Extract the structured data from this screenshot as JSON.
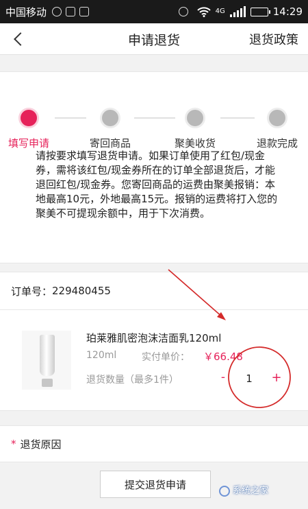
{
  "status_bar": {
    "carrier": "中国移动",
    "network": "4G",
    "time": "14:29",
    "battery_level": 0.6
  },
  "nav": {
    "title": "申请退货",
    "right_label": "退货政策",
    "back_icon": "chevron-left-icon"
  },
  "steps": [
    {
      "label": "填写申请",
      "active": true
    },
    {
      "label": "寄回商品",
      "active": false
    },
    {
      "label": "聚美收货",
      "active": false
    },
    {
      "label": "退款完成",
      "active": false
    }
  ],
  "notice": "请按要求填写退货申请。如果订单使用了红包/现金券，需将该红包/现金券所在的订单全部退货后，才能退回红包/现金券。您寄回商品的运费由聚美报销：本地最高10元，外地最高15元。报销的运费将打入您的聚美不可提现余额中，用于下次消费。",
  "order": {
    "label": "订单号：",
    "number": "229480455"
  },
  "product": {
    "name": "珀莱雅肌密泡沫洁面乳120ml",
    "spec": "120ml",
    "price_label": "实付单价：",
    "price": "￥66.48",
    "qty_label": "退货数量（最多1件）",
    "qty_minus": "-",
    "qty_value": "1",
    "qty_plus": "+"
  },
  "reason": {
    "required_mark": "*",
    "label": "退货原因"
  },
  "submit_label": "提交退货申请",
  "watermark": "系统之家",
  "colors": {
    "accent": "#e6225a",
    "annotation": "#d42a2a"
  }
}
